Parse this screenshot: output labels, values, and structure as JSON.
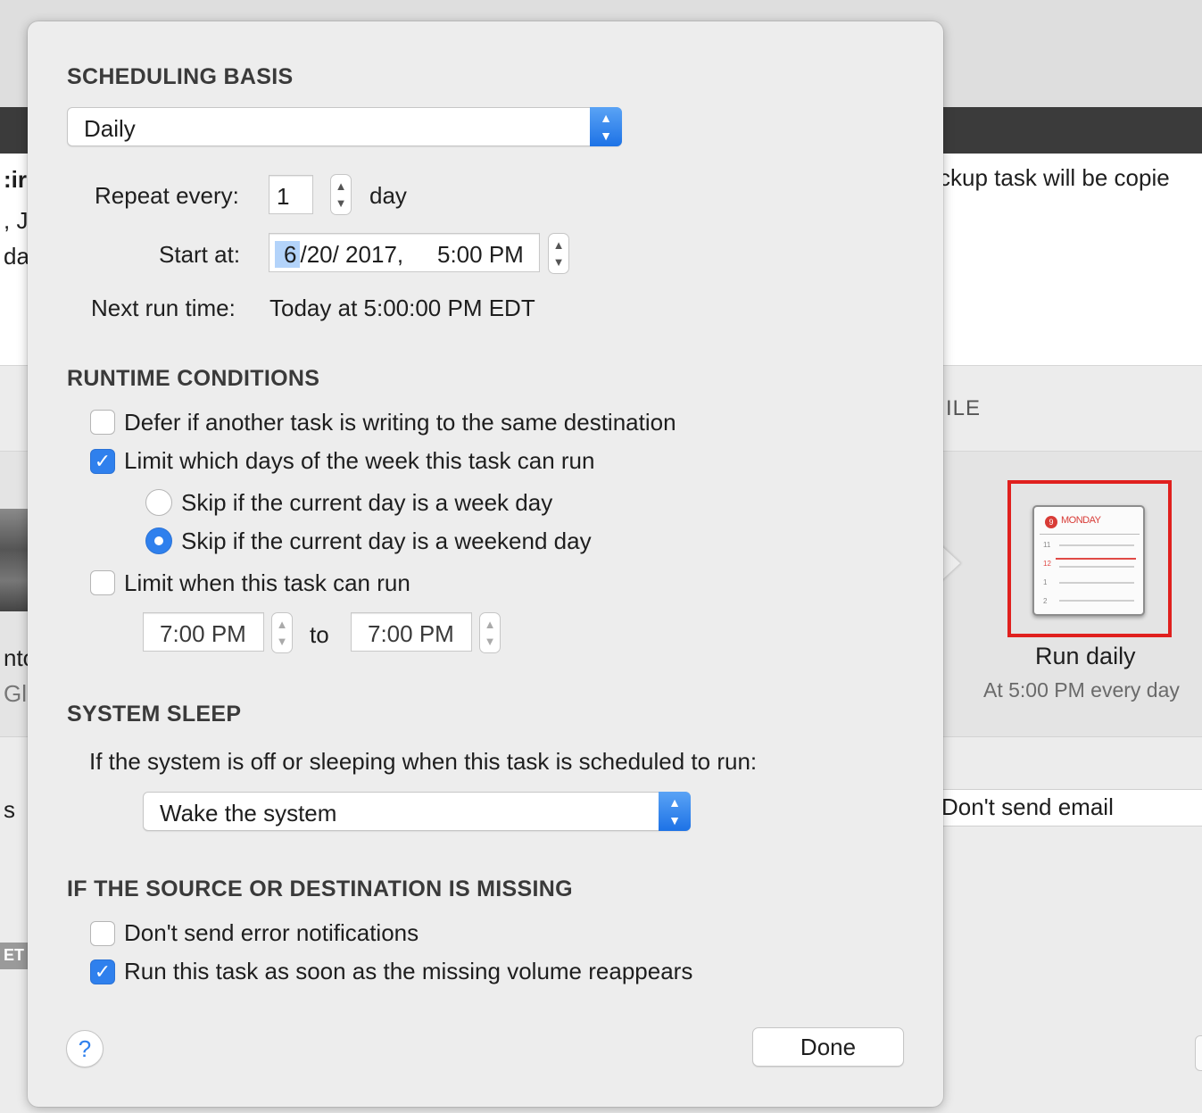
{
  "background": {
    "right_message": "ckup task will be copie",
    "column_header_fragment": "ILE",
    "run_schedule_title": "Run daily",
    "run_schedule_subtitle": "At 5:00 PM every day",
    "email_field": "Don't send email",
    "left_fragments": [
      ":ir",
      ", J",
      "da",
      "nto",
      "Gl",
      "s",
      "ET"
    ],
    "task_icon_day": "MONDAY",
    "task_icon_badge": "9",
    "task_icon_hours": [
      "11",
      "12",
      "1",
      "2"
    ]
  },
  "scheduling": {
    "title": "SCHEDULING BASIS",
    "basis_value": "Daily",
    "repeat_label": "Repeat every:",
    "repeat_value": "1",
    "repeat_unit": "day",
    "start_label": "Start at:",
    "start_month": "6",
    "start_rest": "/20/ 2017,",
    "start_time": "5:00 PM",
    "next_run_label": "Next run time:",
    "next_run_value": "Today at 5:00:00 PM EDT"
  },
  "runtime": {
    "title": "RUNTIME CONDITIONS",
    "defer_label": "Defer if another task is writing to the same destination",
    "defer_checked": false,
    "limit_days_label": "Limit which days of the week this task can run",
    "limit_days_checked": true,
    "skip_weekday_label": "Skip if the current day is a week day",
    "skip_weekend_label": "Skip if the current day is a weekend day",
    "selected_skip": "weekend",
    "limit_time_label": "Limit when this task can run",
    "limit_time_checked": false,
    "from_time": "7:00 PM",
    "to_label": "to",
    "to_time": "7:00 PM"
  },
  "sleep": {
    "title": "SYSTEM SLEEP",
    "description": "If the system is off or sleeping when this task is scheduled to run:",
    "action_value": "Wake the system"
  },
  "missing": {
    "title": "IF THE SOURCE OR DESTINATION IS MISSING",
    "no_error_label": "Don't send error notifications",
    "no_error_checked": false,
    "run_on_reappear_label": "Run this task as soon as the missing volume reappears",
    "run_on_reappear_checked": true
  },
  "footer": {
    "help_symbol": "?",
    "done_label": "Done"
  },
  "colors": {
    "accent": "#2f80ed",
    "highlight_frame": "#e0201e"
  }
}
